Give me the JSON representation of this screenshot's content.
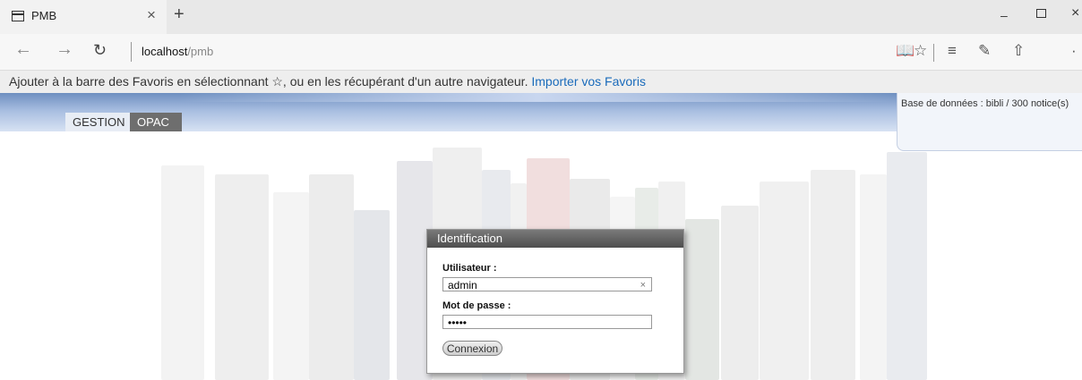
{
  "browser": {
    "tab_title": "PMB",
    "tab_close": "×",
    "new_tab": "+",
    "window": {
      "minimize": "–",
      "close": "×"
    },
    "nav": {
      "back": "←",
      "forward": "→",
      "reload": "↻"
    },
    "address": {
      "host": "localhost",
      "path": "/pmb"
    },
    "tools": {
      "reading": "📖",
      "favorite": "☆",
      "hub": "≡",
      "note": "✎",
      "share": "⇧",
      "more": "·"
    },
    "favbar": {
      "text": "Ajouter à la barre des Favoris en sélectionnant ☆, ou en les récupérant d'un autre navigateur.",
      "link": "Importer vos Favoris"
    }
  },
  "page": {
    "db_info": "Base de données : bibli / 300 notice(s)",
    "tabs": {
      "gestion": "GESTION",
      "opac": "OPAC"
    },
    "login": {
      "title": "Identification",
      "user_label": "Utilisateur :",
      "user_value": "admin",
      "clear_icon": "×",
      "password_label": "Mot de passe :",
      "password_value": "•••••",
      "submit": "Connexion"
    }
  },
  "colors": {
    "header_blue": "#8aa7d4",
    "opac_tab": "#6e6e6e",
    "link": "#1a6bbb"
  }
}
